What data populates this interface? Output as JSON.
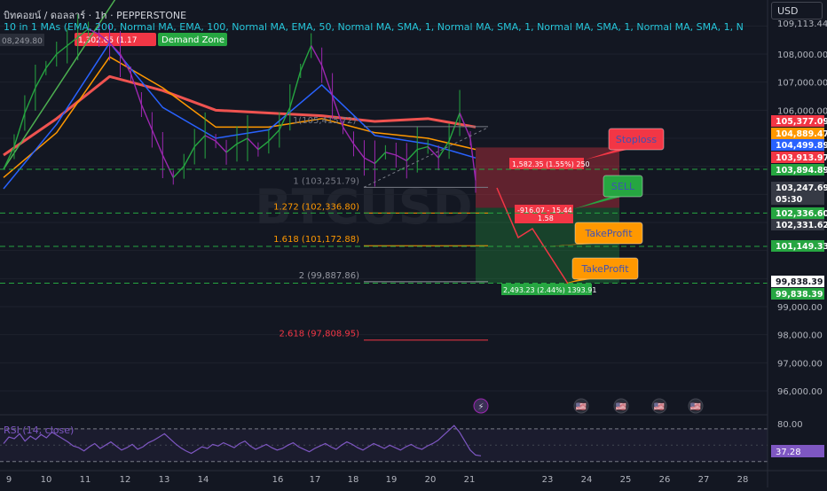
{
  "header": {
    "symbol_line": "บิทคอยน์ / ดอลลาร์ · 1h · PEPPERSTONE",
    "indicator_line": "10 in 1 MAs (EMA, 200, Normal MA, EMA, 100, Normal MA, EMA, 50, Normal MA, SMA, 1, Normal MA, SMA, 1, Normal MA, SMA, 1, Normal MA, SMA, 1, N",
    "currency_button": "USD"
  },
  "watermark": "BTCUSD",
  "demand_zone": {
    "label": "Demand Zone",
    "left_value": "08,249.80",
    "price_tag": "1,302.65 (1.17"
  },
  "chart_data": {
    "type": "line",
    "symbol": "BTCUSD",
    "price_axis_ticks": [
      109000,
      108000,
      107000,
      106000,
      105000,
      104000,
      103000,
      102000,
      101000,
      100000,
      99000,
      98000,
      97000,
      96000
    ],
    "price_axis_tick_labels": [
      "108,000.00",
      "107,000.00",
      "106,000.00",
      "99,000.00",
      "98,000.00",
      "97,000.00",
      "96,000.00"
    ],
    "price_axis_top_label": "109,113.44",
    "ylim": [
      95500,
      109300
    ],
    "x_tick_labels": [
      "9",
      "10",
      "11",
      "12",
      "13",
      "14",
      "16",
      "17",
      "18",
      "19",
      "20",
      "21",
      "23",
      "24",
      "25",
      "26",
      "27",
      "28"
    ],
    "price_series": [
      {
        "x": 0,
        "y": 103900
      },
      {
        "x": 2,
        "y": 104700
      },
      {
        "x": 4,
        "y": 105900
      },
      {
        "x": 6,
        "y": 106800
      },
      {
        "x": 8,
        "y": 107500
      },
      {
        "x": 10,
        "y": 108000
      },
      {
        "x": 12,
        "y": 108300
      },
      {
        "x": 14,
        "y": 108600
      },
      {
        "x": 16,
        "y": 108900
      },
      {
        "x": 18,
        "y": 108700
      },
      {
        "x": 20,
        "y": 108400
      },
      {
        "x": 22,
        "y": 108000
      },
      {
        "x": 24,
        "y": 107300
      },
      {
        "x": 26,
        "y": 106200
      },
      {
        "x": 28,
        "y": 105300
      },
      {
        "x": 30,
        "y": 104400
      },
      {
        "x": 32,
        "y": 103600
      },
      {
        "x": 34,
        "y": 104000
      },
      {
        "x": 36,
        "y": 104700
      },
      {
        "x": 38,
        "y": 105100
      },
      {
        "x": 40,
        "y": 104900
      },
      {
        "x": 42,
        "y": 104500
      },
      {
        "x": 44,
        "y": 104800
      },
      {
        "x": 46,
        "y": 105000
      },
      {
        "x": 48,
        "y": 104600
      },
      {
        "x": 50,
        "y": 104900
      },
      {
        "x": 52,
        "y": 105300
      },
      {
        "x": 54,
        "y": 106100
      },
      {
        "x": 56,
        "y": 107400
      },
      {
        "x": 58,
        "y": 108300
      },
      {
        "x": 60,
        "y": 107600
      },
      {
        "x": 62,
        "y": 106500
      },
      {
        "x": 64,
        "y": 105400
      },
      {
        "x": 66,
        "y": 104800
      },
      {
        "x": 68,
        "y": 104300
      },
      {
        "x": 70,
        "y": 104100
      },
      {
        "x": 72,
        "y": 104500
      },
      {
        "x": 74,
        "y": 104400
      },
      {
        "x": 76,
        "y": 104200
      },
      {
        "x": 78,
        "y": 104600
      },
      {
        "x": 80,
        "y": 104700
      },
      {
        "x": 82,
        "y": 104300
      },
      {
        "x": 84,
        "y": 104900
      },
      {
        "x": 86,
        "y": 105900
      },
      {
        "x": 88,
        "y": 105000
      },
      {
        "x": 89,
        "y": 103500
      }
    ],
    "moving_averages": [
      {
        "name": "EMA 200",
        "color": "#ef5350",
        "values": [
          {
            "x": 0,
            "y": 104400
          },
          {
            "x": 10,
            "y": 105700
          },
          {
            "x": 20,
            "y": 107200
          },
          {
            "x": 30,
            "y": 106700
          },
          {
            "x": 40,
            "y": 106000
          },
          {
            "x": 50,
            "y": 105900
          },
          {
            "x": 60,
            "y": 105800
          },
          {
            "x": 70,
            "y": 105600
          },
          {
            "x": 80,
            "y": 105700
          },
          {
            "x": 89,
            "y": 105400
          }
        ]
      },
      {
        "name": "EMA 100",
        "color": "#ff9800",
        "values": [
          {
            "x": 0,
            "y": 103600
          },
          {
            "x": 10,
            "y": 105200
          },
          {
            "x": 20,
            "y": 107900
          },
          {
            "x": 30,
            "y": 106800
          },
          {
            "x": 40,
            "y": 105400
          },
          {
            "x": 50,
            "y": 105400
          },
          {
            "x": 60,
            "y": 105700
          },
          {
            "x": 70,
            "y": 105200
          },
          {
            "x": 80,
            "y": 105000
          },
          {
            "x": 89,
            "y": 104600
          }
        ]
      },
      {
        "name": "EMA 50",
        "color": "#2962ff",
        "values": [
          {
            "x": 0,
            "y": 103200
          },
          {
            "x": 10,
            "y": 105500
          },
          {
            "x": 20,
            "y": 108400
          },
          {
            "x": 30,
            "y": 106100
          },
          {
            "x": 40,
            "y": 105000
          },
          {
            "x": 50,
            "y": 105300
          },
          {
            "x": 60,
            "y": 106900
          },
          {
            "x": 70,
            "y": 105100
          },
          {
            "x": 80,
            "y": 104800
          },
          {
            "x": 89,
            "y": 104300
          }
        ]
      },
      {
        "name": "trend",
        "color": "#4caf50",
        "values": [
          {
            "x": 0,
            "y": 103900
          },
          {
            "x": 24,
            "y": 110800
          }
        ]
      }
    ],
    "fib_levels": [
      {
        "label": "1 (103,251.79)",
        "price": 103251.79,
        "color": "#787b86"
      },
      {
        "label": "1.272 (102,336.80)",
        "price": 102336.8,
        "color": "#ff9800"
      },
      {
        "label": "1.618 (101,172.88)",
        "price": 101172.88,
        "color": "#ff9800"
      },
      {
        "label": "2 (99,887.86)",
        "price": 99887.86,
        "color": "#9598a1"
      },
      {
        "label": "2.618 (97,808.95)",
        "price": 97808.95,
        "color": "#f23645"
      }
    ],
    "fib_top_label": "1(105,415.72)",
    "dashed_levels": [
      103894.89,
      102336.6,
      101149.33,
      99838.39
    ],
    "price_labels": [
      {
        "text": "105,377.09",
        "bg": "#f23645"
      },
      {
        "text": "104,889.47",
        "bg": "#ff9800"
      },
      {
        "text": "104,499.89",
        "bg": "#2962ff"
      },
      {
        "text": "103,913.97",
        "bg": "#f23645"
      },
      {
        "text": "103,894.89",
        "bg": "#26a641"
      },
      {
        "text": "103,247.69",
        "bg": "#363a45"
      },
      {
        "text": "05:30",
        "bg": "#363a45"
      },
      {
        "text": "102,336.60",
        "bg": "#26a641"
      },
      {
        "text": "102,331.62",
        "bg": "#363a45"
      },
      {
        "text": "101,149.33",
        "bg": "#26a641"
      },
      {
        "text": "99,838.39",
        "bg": "#ffffff"
      },
      {
        "text": "99,838.39",
        "bg": "#26a641"
      }
    ],
    "position": {
      "type": "short",
      "entry": 103247.69,
      "stop": 103913.97,
      "target": 99838.39,
      "stop_label": "1,582.35 (1.55%) 250",
      "target_label": "2,493.23 (2.44%) 1393.91",
      "center_label_line1": "-916.07 - 15.44",
      "center_label_line2": "1.58"
    },
    "callouts": [
      {
        "text": "Stoploss",
        "bg": "#f23645"
      },
      {
        "text": "SELL",
        "bg": "#26a641"
      },
      {
        "text": "TakeProfit",
        "bg": "#ff9800"
      },
      {
        "text": "TakeProfit",
        "bg": "#ff9800"
      }
    ],
    "rsi": {
      "label": "RSI (14, close)",
      "ylim": [
        20,
        85
      ],
      "level_labels": [
        "80.00"
      ],
      "current": "37.28",
      "values": [
        52,
        60,
        58,
        64,
        55,
        61,
        57,
        63,
        59,
        66,
        62,
        58,
        54,
        49,
        47,
        43,
        48,
        52,
        46,
        50,
        54,
        49,
        44,
        47,
        51,
        45,
        48,
        53,
        56,
        60,
        64,
        58,
        52,
        47,
        43,
        40,
        44,
        48,
        46,
        51,
        49,
        53,
        50,
        47,
        52,
        55,
        49,
        45,
        48,
        51,
        47,
        44,
        46,
        50,
        53,
        48,
        45,
        42,
        46,
        49,
        52,
        48,
        45,
        50,
        54,
        51,
        47,
        44,
        48,
        52,
        49,
        46,
        50,
        47,
        44,
        48,
        51,
        47,
        45,
        49,
        52,
        56,
        62,
        68,
        74,
        66,
        55,
        44,
        38,
        37
      ]
    },
    "event_icons": [
      "⚡",
      "🇺🇸",
      "🇺🇸",
      "🇺🇸",
      "🇺🇸"
    ]
  }
}
